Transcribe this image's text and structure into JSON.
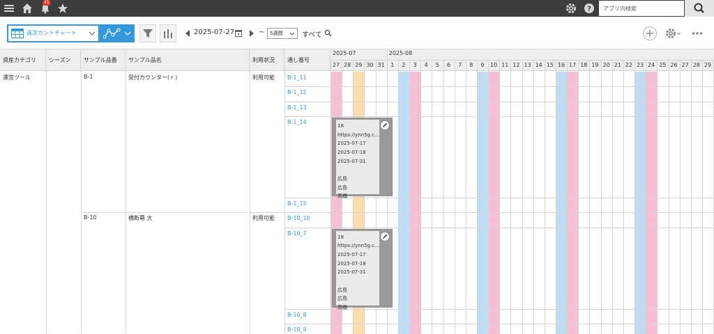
{
  "topbar": {
    "notification_count": "41",
    "search": {
      "placeholder": "アプリ内検索",
      "value": ""
    }
  },
  "toolbar": {
    "view_label": "週次ガントチャート",
    "date": "2025-07-27",
    "tilde": "~",
    "weeks_value": "5週間",
    "filter_all": "すべて"
  },
  "table": {
    "headers": {
      "category": "資産カテゴリ",
      "season": "シーズン",
      "product_no": "サンプル品番",
      "product_name": "サンプル品名",
      "status": "利用状況",
      "serial": "通し番号"
    },
    "months": [
      "2025-07",
      "2025-08"
    ],
    "days": [
      "27",
      "28",
      "29",
      "30",
      "31",
      "1",
      "2",
      "3",
      "4",
      "5",
      "6",
      "7",
      "8",
      "9",
      "10",
      "11",
      "12",
      "13",
      "14",
      "15",
      "16",
      "17",
      "18",
      "19",
      "20",
      "21",
      "22",
      "23",
      "24",
      "25",
      "26",
      "27",
      "28",
      "29"
    ],
    "highlight_colors": {
      "saturday": "#bfdcf5",
      "sunday": "#f7bfd3",
      "today": "#fddcad"
    },
    "category": "運営ツール",
    "groups": [
      {
        "product_no": "B-1",
        "product_name": "受付カウンター(ｒ)",
        "status": "利用可能",
        "serials": [
          "B-1_11",
          "B-1_12",
          "B-1_13",
          "B-1_14",
          "B-1_15"
        ]
      },
      {
        "product_no": "B-10",
        "product_name": "横断幕 大",
        "status": "利用可能",
        "serials": [
          "B-10_10",
          "B-10_7",
          "B-10_8",
          "B-10_9"
        ]
      }
    ],
    "bars": [
      {
        "lines": [
          "18",
          "https://ynn5g.c…",
          "2025-07-17",
          "2025-07-18",
          "2025-07-31",
          "",
          "広島",
          "広島",
          "高橋"
        ]
      },
      {
        "lines": [
          "18",
          "https://ynn5g.c…",
          "2025-07-17",
          "2025-07-18",
          "2025-07-31",
          "",
          "広島",
          "広島",
          "高橋"
        ]
      }
    ]
  }
}
